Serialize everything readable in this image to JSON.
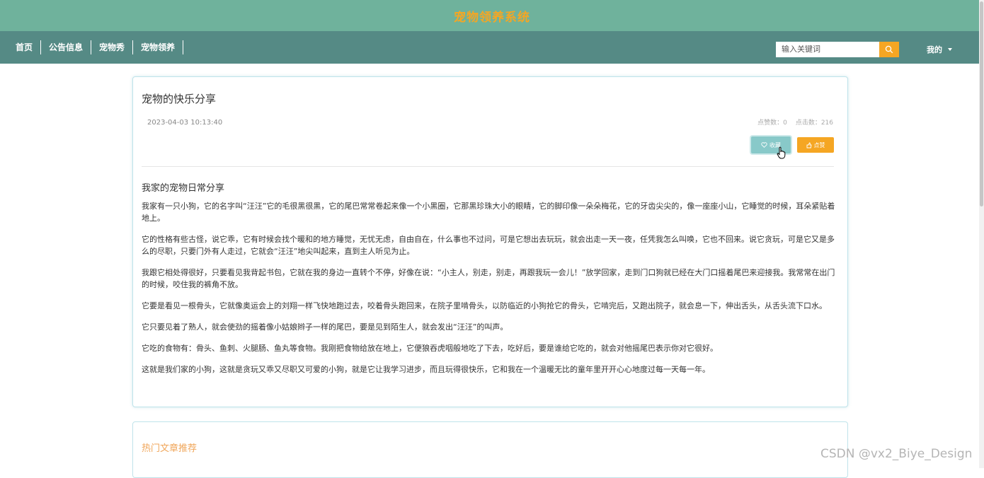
{
  "header": {
    "site_title": "宠物领养系统"
  },
  "nav": {
    "items": [
      "首页",
      "公告信息",
      "宠物秀",
      "宠物领养"
    ],
    "search_placeholder": "输入关键词",
    "user_menu": "我的"
  },
  "article": {
    "title": "宠物的快乐分享",
    "date": "2023-04-03 10:13:40",
    "likes_label": "点赞数：0",
    "clicks_label": "点击数：216",
    "fav_button": "收藏",
    "like_button": "点赞",
    "subheading": "我家的宠物日常分享",
    "paragraphs": [
      "我家有一只小狗，它的名字叫“汪汪”它的毛很黑很黑，它的尾巴常常卷起来像一个小黑圈，它那黑珍珠大小的眼睛，它的脚印像一朵朵梅花，它的牙齿尖尖的，像一座座小山，它睡觉的时候，耳朵紧贴着地上。",
      "它的性格有些古怪，说它乖，它有时候会找个暖和的地方睡觉，无忧无虑，自由自在，什么事也不过问，可是它想出去玩玩，就会出走一天一夜，任凭我怎么叫唤，它也不回来。说它贪玩，可是它又是多么的尽职，只要门外有人走过，它就会“汪汪”地尖叫起来，直到主人听见为止。",
      "我跟它相处得很好，只要看见我背起书包，它就在我的身边一直转个不停，好像在说：“小主人，别走，别走，再跟我玩一会儿！”放学回家，走到门口狗就已经在大门口摇着尾巴来迎接我。我常常在出门的时候，咬住我的裤角不放。",
      "它要是看见一根骨头，它就像奥运会上的刘翔一样飞快地跑过去，咬着骨头跑回来，在院子里啃骨头，以防临近的小狗抢它的骨头，它啃完后，又跑出院子，就会息一下，伸出舌头，从舌头流下口水。",
      "它只要见着了熟人，就会使劲的摇着像小姑娘辫子一样的尾巴，要是见到陌生人，就会发出“汪汪”的叫声。",
      "它吃的食物有：骨头、鱼刺、火腿肠、鱼丸等食物。我刚把食物给放在地上，它便狼吞虎咽般地吃了下去，吃好后，要是谁给它吃的，就会对他摇尾巴表示你对它很好。",
      "这就是我们家的小狗，这就是贪玩又乖又尽职又可爱的小狗，就是它让我学习进步，而且玩得很快乐，它和我在一个温暖无比的童年里开开心心地度过每一天每一年。"
    ]
  },
  "recommend": {
    "title": "热门文章推荐"
  },
  "watermark": "CSDN @vx2_Biye_Design",
  "colors": {
    "topbar": "#6fb29c",
    "navbar": "#558a85",
    "accent": "#f5a623",
    "fav": "#88c9c9"
  }
}
